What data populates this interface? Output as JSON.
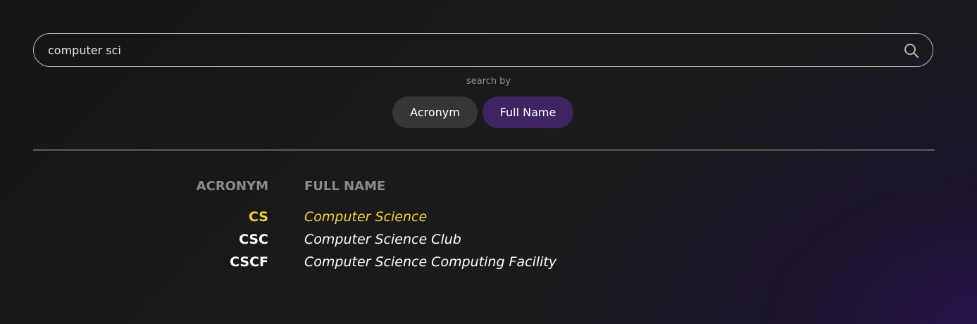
{
  "search": {
    "value": "computer sci",
    "placeholder": ""
  },
  "search_by_label": "search by",
  "toggles": {
    "acronym": "Acronym",
    "full_name": "Full Name",
    "active": "full_name"
  },
  "colors": {
    "highlight": "#f5cf35",
    "active_toggle": "#3e2463",
    "inactive_toggle": "#363636"
  },
  "table": {
    "headers": {
      "acronym": "ACRONYM",
      "full_name": "FULL NAME"
    },
    "rows": [
      {
        "acronym": "CS",
        "full_name": "Computer Science",
        "highlighted": true
      },
      {
        "acronym": "CSC",
        "full_name": "Computer Science Club",
        "highlighted": false
      },
      {
        "acronym": "CSCF",
        "full_name": "Computer Science Computing Facility",
        "highlighted": false
      }
    ]
  }
}
